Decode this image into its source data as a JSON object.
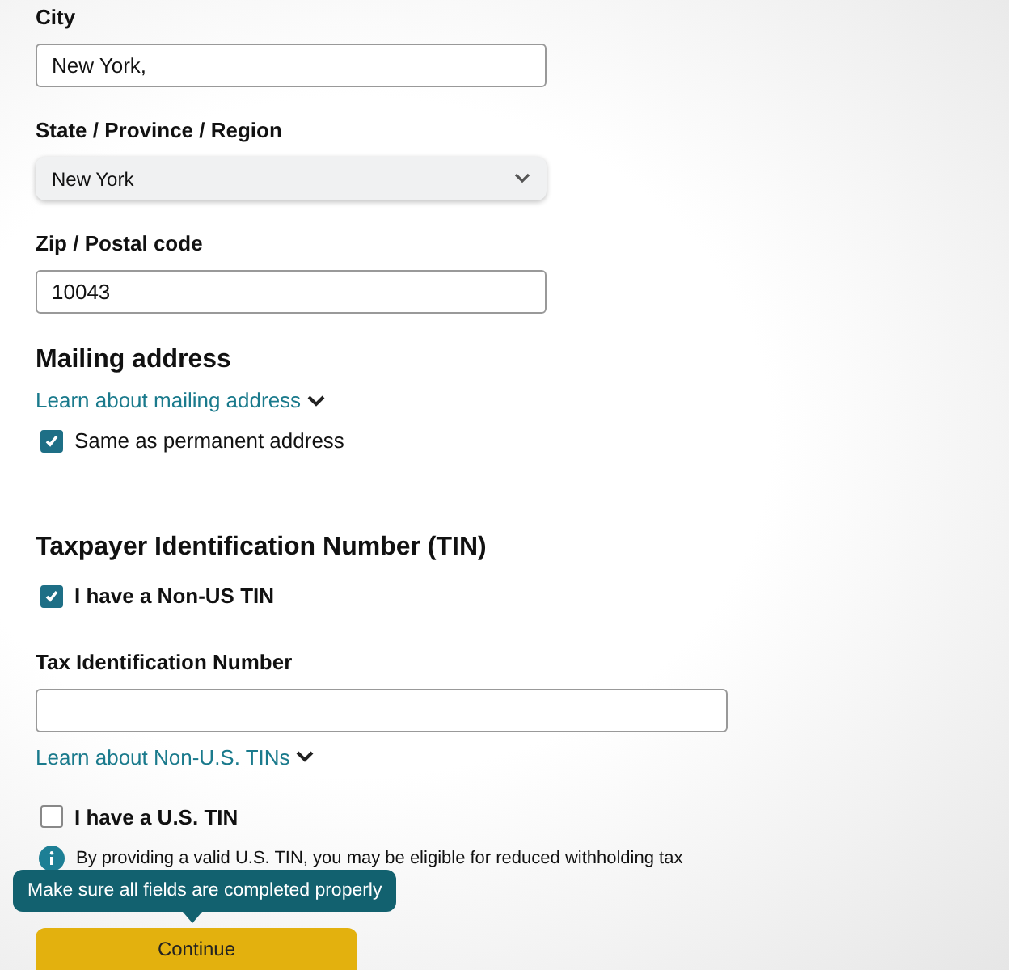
{
  "fields": [
    {
      "kind": "text",
      "label": "City",
      "value": "New York,"
    },
    {
      "kind": "select",
      "label": "State / Province / Region",
      "value": "New York"
    },
    {
      "kind": "text",
      "label": "Zip / Postal code",
      "value": "10043"
    }
  ],
  "mailing": {
    "heading": "Mailing address",
    "link": "Learn about mailing address",
    "checkbox": {
      "label": "Same as permanent address",
      "checked": true
    }
  },
  "tin": {
    "heading": "Taxpayer Identification Number (TIN)",
    "non_us": {
      "label": "I have a Non-US TIN",
      "checked": true
    },
    "field": {
      "label": "Tax Identification Number"
    },
    "link": "Learn about Non-U.S. TINs",
    "us": {
      "label": "I have a U.S. TIN",
      "checked": false
    },
    "info": "By providing a valid U.S. TIN, you may be eligible for reduced withholding tax"
  },
  "tooltip": "Make sure all fields are completed properly",
  "continue_button": "Continue"
}
